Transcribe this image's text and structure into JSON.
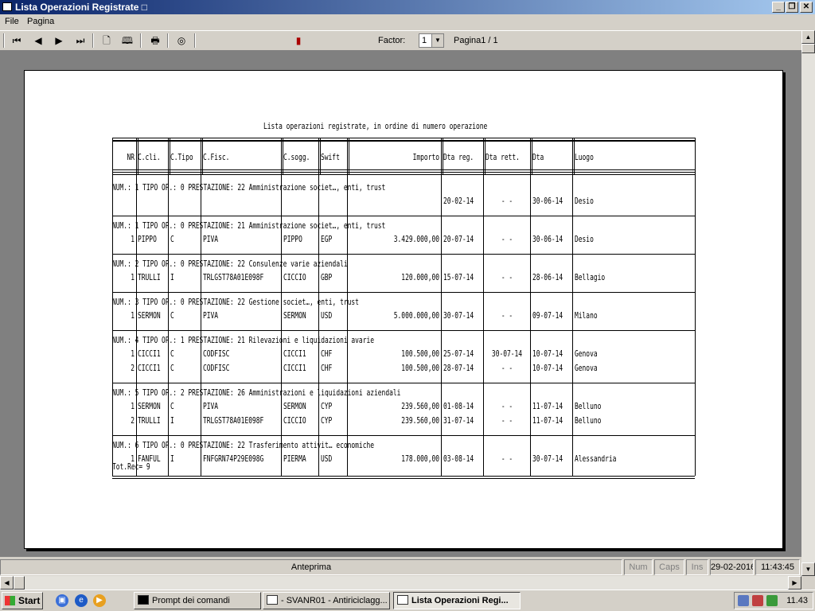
{
  "window": {
    "title": "Lista Operazioni Registrate □"
  },
  "menu": [
    "File",
    "Pagina"
  ],
  "toolbar": {
    "factor_label": "Factor:",
    "factor_value": "1",
    "page_label": "Pagina1 / 1"
  },
  "report": {
    "title": "Lista operazioni registrate, in ordine di numero operazione",
    "headers": [
      "NR",
      "C.cli.",
      "C.Tipo",
      "C.Fisc.",
      "C.sogg.",
      "Swift",
      "Importo",
      "Dta reg.",
      "Dta rett.",
      "Dta",
      "Luogo"
    ],
    "groups": [
      {
        "header": "NUM.:      1   TIPO OP.: 0  PRESTAZIONE: 22  Amministrazione societ…, enti, trust",
        "rows": [
          {
            "nr": "",
            "cli": "",
            "tipo": "",
            "fisc": "",
            "sogg": "",
            "swift": "",
            "importo": "",
            "dreg": "20-02-14",
            "drett": "-  -",
            "dta": "30-06-14",
            "luogo": "Desio"
          }
        ]
      },
      {
        "header": "NUM.:      1   TIPO OP.: 0  PRESTAZIONE: 21  Amministrazione societ…, enti, trust",
        "rows": [
          {
            "nr": "1",
            "cli": "PIPPO",
            "tipo": "C",
            "fisc": "PIVA",
            "sogg": "PIPPO",
            "swift": "EGP",
            "importo": "3.429.000,00",
            "dreg": "20-07-14",
            "drett": "-  -",
            "dta": "30-06-14",
            "luogo": "Desio"
          }
        ]
      },
      {
        "header": "NUM.:      2   TIPO OP.: 0  PRESTAZIONE: 22  Consulenze varie aziendali",
        "rows": [
          {
            "nr": "1",
            "cli": "TRULLI",
            "tipo": "I",
            "fisc": "TRLGST78A01E098F",
            "sogg": "CICCIO",
            "swift": "GBP",
            "importo": "120.000,00",
            "dreg": "15-07-14",
            "drett": "-  -",
            "dta": "28-06-14",
            "luogo": "Bellagio"
          }
        ]
      },
      {
        "header": "NUM.:      3   TIPO OP.: 0  PRESTAZIONE: 22  Gestione societ…, enti, trust",
        "rows": [
          {
            "nr": "1",
            "cli": "SERMON",
            "tipo": "C",
            "fisc": "PIVA",
            "sogg": "SERMON",
            "swift": "USD",
            "importo": "5.000.000,00",
            "dreg": "30-07-14",
            "drett": "-  -",
            "dta": "09-07-14",
            "luogo": "Milano"
          }
        ]
      },
      {
        "header": "NUM.:      4   TIPO OP.: 1  PRESTAZIONE: 21  Rilevazioni e liquidazioni avarie",
        "rows": [
          {
            "nr": "1",
            "cli": "CICCI1",
            "tipo": "C",
            "fisc": "CODFISC",
            "sogg": "CICCI1",
            "swift": "CHF",
            "importo": "100.500,00",
            "dreg": "25-07-14",
            "drett": "30-07-14",
            "dta": "10-07-14",
            "luogo": "Genova"
          },
          {
            "nr": "2",
            "cli": "CICCI1",
            "tipo": "C",
            "fisc": "CODFISC",
            "sogg": "CICCI1",
            "swift": "CHF",
            "importo": "100.500,00",
            "dreg": "28-07-14",
            "drett": "-  -",
            "dta": "10-07-14",
            "luogo": "Genova"
          }
        ]
      },
      {
        "header": "NUM.:      5   TIPO OP.: 2  PRESTAZIONE: 26  Amministrazioni e liquidazioni aziendali",
        "rows": [
          {
            "nr": "1",
            "cli": "SERMON",
            "tipo": "C",
            "fisc": "PIVA",
            "sogg": "SERMON",
            "swift": "CYP",
            "importo": "239.560,00",
            "dreg": "01-08-14",
            "drett": "-  -",
            "dta": "11-07-14",
            "luogo": "Belluno"
          },
          {
            "nr": "2",
            "cli": "TRULLI",
            "tipo": "I",
            "fisc": "TRLGST78A01E098F",
            "sogg": "CICCIO",
            "swift": "CYP",
            "importo": "239.560,00",
            "dreg": "31-07-14",
            "drett": "-  -",
            "dta": "11-07-14",
            "luogo": "Belluno"
          }
        ]
      },
      {
        "header": "NUM.:      6   TIPO OP.: 0  PRESTAZIONE: 22  Trasferimento attivit… economiche",
        "rows": [
          {
            "nr": "1",
            "cli": "FANFUL",
            "tipo": "I",
            "fisc": "FNFGRN74P29E098G",
            "sogg": "PIERMA",
            "swift": "USD",
            "importo": "178.000,00",
            "dreg": "03-08-14",
            "drett": "-  -",
            "dta": "30-07-14",
            "luogo": "Alessandria"
          }
        ]
      }
    ],
    "total": "Tot.Rec= 9"
  },
  "status": {
    "mode": "Anteprima",
    "num": "Num",
    "caps": "Caps",
    "ins": "Ins",
    "date": "29-02-2016",
    "time": "11:43:45"
  },
  "taskbar": {
    "start": "Start",
    "tasks": [
      "Prompt dei comandi",
      "- SVANR01 - Antiriciclagg...",
      "Lista Operazioni Regi..."
    ],
    "clock": "11.43"
  }
}
